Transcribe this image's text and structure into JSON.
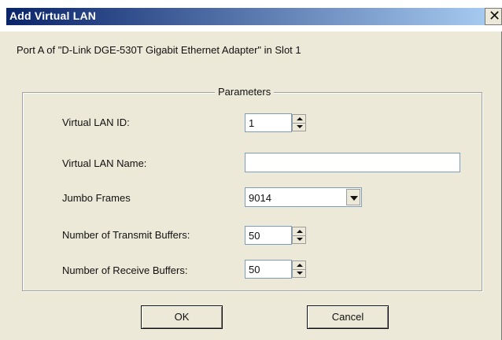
{
  "window": {
    "title": "Add Virtual LAN"
  },
  "header": {
    "port_text": "Port A of \"D-Link DGE-530T Gigabit Ethernet Adapter\" in Slot 1"
  },
  "parameters": {
    "group_label": "Parameters",
    "virtual_lan_id": {
      "label": "Virtual LAN ID:",
      "value": "1"
    },
    "virtual_lan_name": {
      "label": "Virtual LAN Name:",
      "value": "",
      "placeholder": ""
    },
    "jumbo_frames": {
      "label": "Jumbo Frames",
      "value": "9014"
    },
    "transmit_buffers": {
      "label": "Number of Transmit Buffers:",
      "value": "50"
    },
    "receive_buffers": {
      "label": "Number of Receive Buffers:",
      "value": "50"
    }
  },
  "buttons": {
    "ok_label": "OK",
    "cancel_label": "Cancel"
  },
  "icons": {
    "close": "close-icon",
    "spin_up": "spin-up-icon",
    "spin_down": "spin-down-icon",
    "dropdown": "chevron-down-icon"
  }
}
